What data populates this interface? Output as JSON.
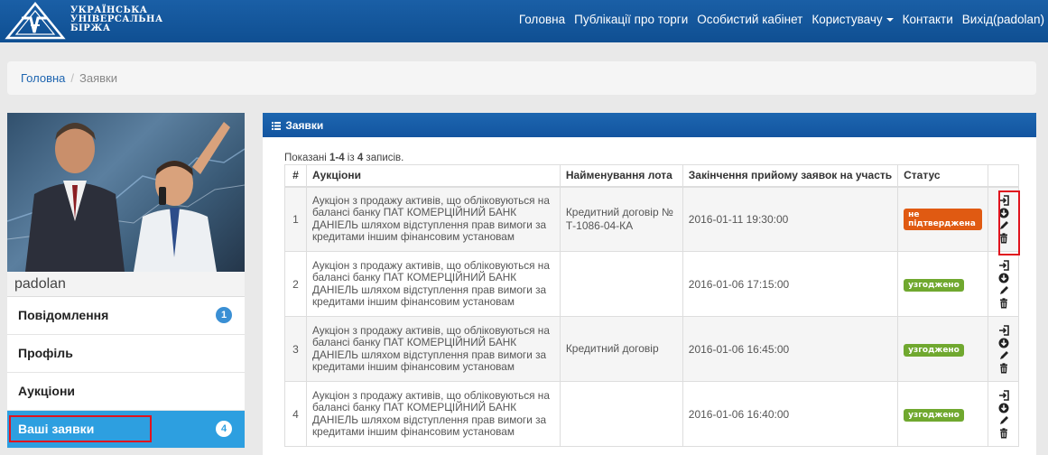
{
  "header": {
    "logo_text": [
      "УКРАЇНСЬКА",
      "УНІВЕРСАЛЬНА",
      "БІРЖА"
    ],
    "nav": {
      "home": "Головна",
      "publications": "Публікації про торги",
      "cabinet": "Особистий кабінет",
      "user": "Користувачу",
      "contacts": "Контакти",
      "logout": "Вихід(padolan)"
    }
  },
  "breadcrumb": {
    "home": "Головна",
    "separator": "/",
    "current": "Заявки"
  },
  "sidebar": {
    "username": "padolan",
    "items": [
      {
        "label": "Повідомлення",
        "badge": "1"
      },
      {
        "label": "Профіль"
      },
      {
        "label": "Аукціони"
      },
      {
        "label": "Ваші заявки",
        "badge": "4",
        "active": true
      }
    ]
  },
  "panel": {
    "title": "Заявки",
    "summary": {
      "prefix": "Показані ",
      "range": "1-4",
      "mid": " із ",
      "total": "4",
      "suffix": " записів."
    },
    "columns": [
      "#",
      "Аукціони",
      "Найменування лота",
      "Закінчення прийому заявок на участь",
      "Статус"
    ],
    "rows": [
      {
        "num": "1",
        "auction": "Аукціон з продажу активів, що обліковуються на балансі банку ПАТ КОМЕРЦІЙНИЙ БАНК ДАНІЕЛЬ шляхом відступлення прав вимоги за кредитами іншим фінансовим установам",
        "lot": "Кредитний договір № Т-1086-04-КА",
        "date": "2016-01-11 19:30:00",
        "status": "не підтверджена"
      },
      {
        "num": "2",
        "auction": "Аукціон з продажу активів, що обліковуються на балансі банку ПАТ КОМЕРЦІЙНИЙ БАНК ДАНІЕЛЬ шляхом відступлення прав вимоги за кредитами іншим фінансовим установам",
        "lot": "",
        "date": "2016-01-06 17:15:00",
        "status": "узгоджено"
      },
      {
        "num": "3",
        "auction": "Аукціон з продажу активів, що обліковуються на балансі банку ПАТ КОМЕРЦІЙНИЙ БАНК ДАНІЕЛЬ шляхом відступлення прав вимоги за кредитами іншим фінансовим установам",
        "lot": "Кредитний договір",
        "date": "2016-01-06 16:45:00",
        "status": "узгоджено"
      },
      {
        "num": "4",
        "auction": "Аукціон з продажу активів, що обліковуються на балансі банку ПАТ КОМЕРЦІЙНИЙ БАНК ДАНІЕЛЬ шляхом відступлення прав вимоги за кредитами іншим фінансовим установам",
        "lot": "",
        "date": "2016-01-06 16:40:00",
        "status": "узгоджено"
      }
    ],
    "action_icons": [
      "login-icon",
      "download-icon",
      "edit-icon",
      "trash-icon"
    ]
  },
  "colors": {
    "brand": "#0f4f92",
    "active": "#2d9fe0",
    "danger": "#e05a12",
    "success": "#70a82f",
    "highlight": "#e0141e"
  }
}
